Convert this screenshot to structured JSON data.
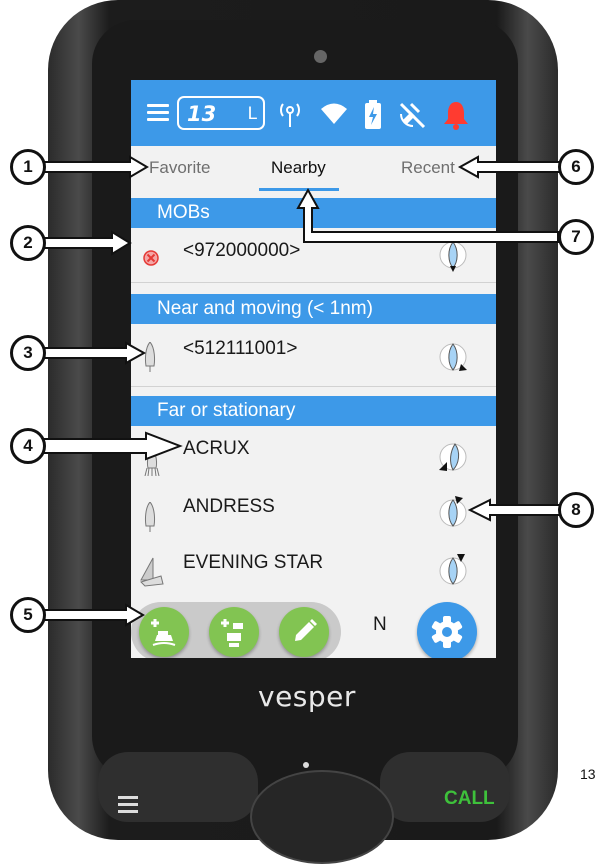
{
  "statusbar": {
    "channel_number": "13",
    "power_level": "L",
    "icons": [
      "menu-icon",
      "antenna-icon",
      "wifi-icon",
      "battery-charging-icon",
      "gps-off-icon",
      "alarm-bell-icon"
    ],
    "colors": {
      "bar": "#3d99e8",
      "alarm": "#ff3b30"
    }
  },
  "tabs": [
    {
      "label": "Favorite",
      "active": false
    },
    {
      "label": "Nearby",
      "active": true
    },
    {
      "label": "Recent",
      "active": false
    }
  ],
  "sections": {
    "mobs": {
      "title": "MOBs",
      "rows": [
        {
          "name": "<972000000>",
          "icon": "mob-cross-icon"
        }
      ]
    },
    "near": {
      "title": "Near and moving (< 1nm)",
      "rows": [
        {
          "name": "<512111001>",
          "icon": "vessel-outline-icon"
        }
      ]
    },
    "far": {
      "title": "Far or stationary",
      "rows": [
        {
          "name": "ACRUX",
          "icon": "vessel-anchored-icon"
        },
        {
          "name": "ANDRESS",
          "icon": "vessel-outline-icon"
        },
        {
          "name": "EVENING STAR",
          "icon": "sailboat-icon"
        },
        {
          "name": "N",
          "icon": "vessel-outline-icon"
        }
      ]
    }
  },
  "fabs": [
    {
      "icon": "add-vessel-icon"
    },
    {
      "icon": "add-group-icon"
    },
    {
      "icon": "edit-pencil-icon"
    }
  ],
  "settings_icon": "gear-icon",
  "brand": "vesper",
  "hardware": {
    "call_label": "CALL",
    "call_color": "#3ec13b"
  },
  "callouts": [
    "1",
    "2",
    "3",
    "4",
    "5",
    "6",
    "7",
    "8"
  ],
  "page_number": "13"
}
